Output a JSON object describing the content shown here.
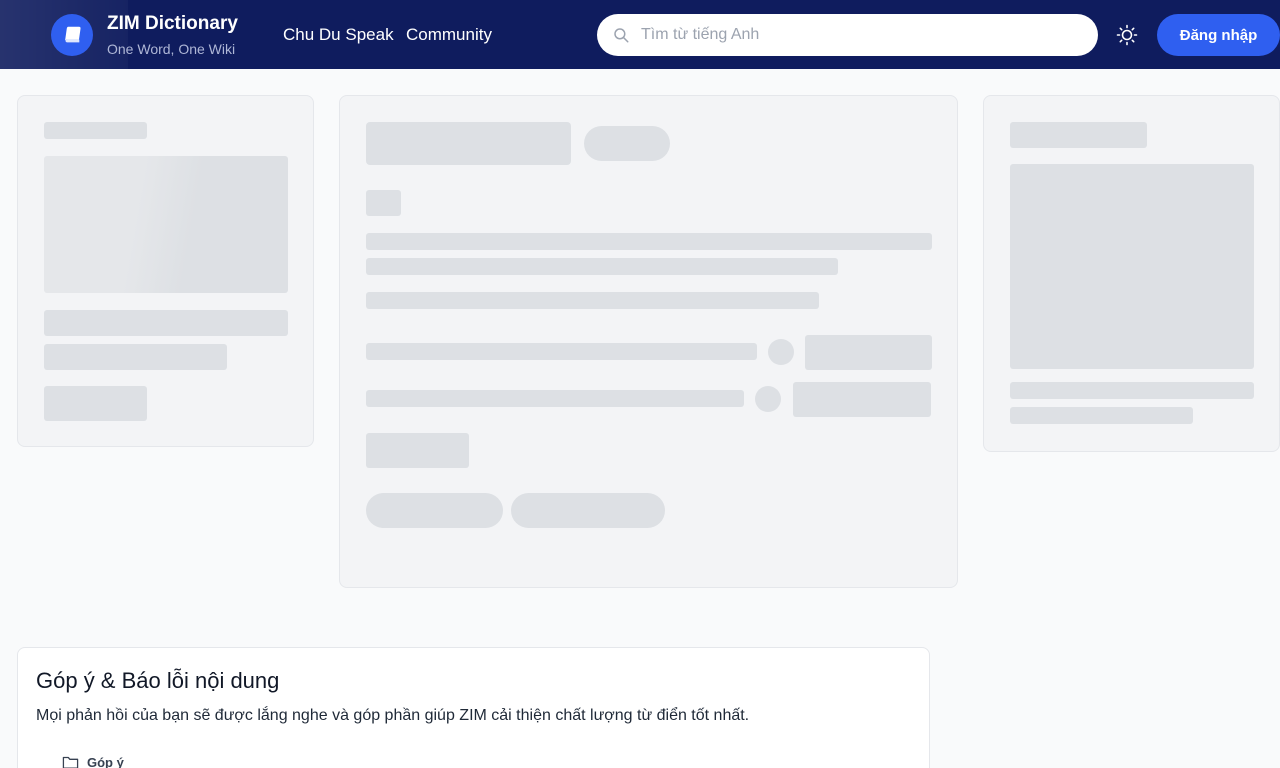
{
  "header": {
    "brand_title": "ZIM Dictionary",
    "brand_subtitle": "One Word, One Wiki",
    "nav": [
      {
        "label": "Chu Du Speak"
      },
      {
        "label": "Community"
      }
    ],
    "search": {
      "placeholder": "Tìm từ tiếng Anh",
      "value": ""
    },
    "login_label": "Đăng nhập",
    "icons": {
      "logo": "book-icon",
      "search": "search-icon",
      "theme": "sun-icon"
    },
    "colors": {
      "header_bg": "#0f1c5e",
      "accent": "#2f5ff0"
    }
  },
  "feedback": {
    "title": "Góp ý & Báo lỗi nội dung",
    "description": "Mọi phản hồi của bạn sẽ được lắng nghe và góp phần giúp ZIM cải thiện chất lượng từ điển tốt nhất.",
    "option_label": "Góp ý",
    "option_icon": "folder-icon"
  }
}
